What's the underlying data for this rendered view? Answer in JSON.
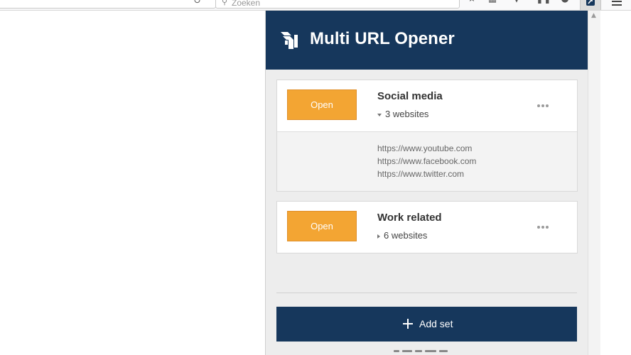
{
  "browser": {
    "search_placeholder": "Zoeken",
    "icons": [
      "reload-icon",
      "search-icon",
      "bookmark-star-icon",
      "library-icon",
      "pocket-icon",
      "pause-icon",
      "profile-icon",
      "multi-url-extension-icon",
      "hamburger-menu-icon"
    ]
  },
  "app": {
    "title": "Multi URL Opener",
    "accent_color": "#16375c",
    "button_color": "#f3a533"
  },
  "sets": [
    {
      "open_label": "Open",
      "name": "Social media",
      "count_label": "3 websites",
      "expanded": true,
      "urls": [
        "https://www.youtube.com",
        "https://www.facebook.com",
        "https://www.twitter.com"
      ]
    },
    {
      "open_label": "Open",
      "name": "Work related",
      "count_label": "6 websites",
      "expanded": false,
      "urls": []
    }
  ],
  "add_set_label": "Add set"
}
